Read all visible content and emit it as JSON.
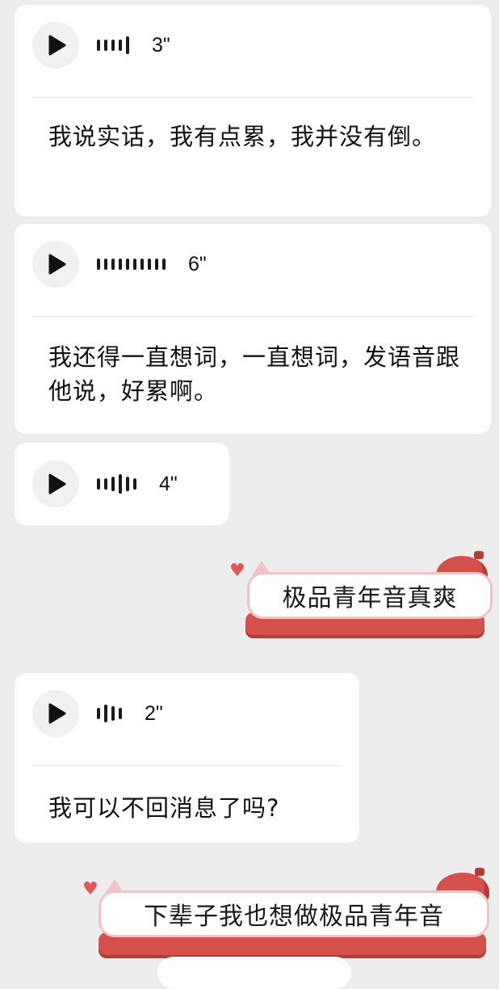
{
  "messages": [
    {
      "type": "voice",
      "duration": "3\"",
      "bars": [
        14,
        14,
        14,
        14,
        22
      ],
      "transcript": "我说实话，我有点累，我并没有倒。"
    },
    {
      "type": "voice",
      "duration": "6\"",
      "bars": [
        14,
        14,
        14,
        14,
        14,
        14,
        14,
        14,
        14,
        14
      ],
      "transcript": "我还得一直想词，一直想词，发语音跟他说，好累啊。"
    },
    {
      "type": "voice",
      "duration": "4\"",
      "bars": [
        14,
        14,
        18,
        24,
        18,
        14
      ]
    },
    {
      "type": "sticker",
      "text": "极品青年音真爽"
    },
    {
      "type": "voice",
      "duration": "2\"",
      "bars": [
        14,
        22,
        18,
        14
      ],
      "transcript": "我可以不回消息了吗?"
    },
    {
      "type": "sticker",
      "text": "下辈子我也想做极品青年音"
    }
  ],
  "colors": {
    "background": "#ededed",
    "bubble": "#ffffff",
    "sticker_red": "#d4504a",
    "sticker_pink": "#f0c3c6"
  },
  "icons": [
    "play-icon",
    "voice-wave-icon",
    "heart-icon",
    "beret-icon"
  ]
}
